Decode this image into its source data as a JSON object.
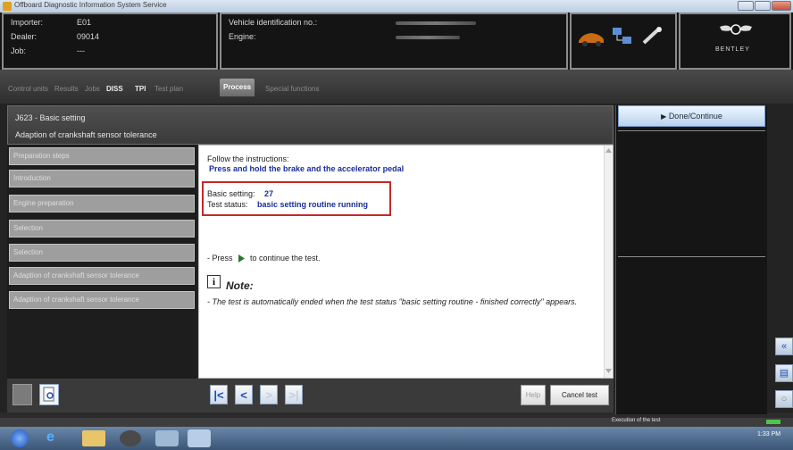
{
  "window": {
    "title": "Offboard Diagnostic Information System Service"
  },
  "header": {
    "importer_label": "Importer:",
    "importer_value": "E01",
    "dealer_label": "Dealer:",
    "dealer_value": "09014",
    "job_label": "Job:",
    "job_value": "---",
    "vin_label": "Vehicle identification no.:",
    "engine_label": "Engine:",
    "brand": "BENTLEY"
  },
  "tabs": [
    {
      "label": "Control units"
    },
    {
      "label": "Results"
    },
    {
      "label": "Jobs"
    },
    {
      "label": "DISS"
    },
    {
      "label": "TPI"
    },
    {
      "label": "Test plan"
    },
    {
      "label": "Process"
    },
    {
      "label": "Special functions"
    }
  ],
  "panel": {
    "title": "J623 - Basic setting",
    "subtitle": "Adaption of crankshaft sensor tolerance"
  },
  "steps": [
    {
      "label": "Preparation steps"
    },
    {
      "label": "Introduction"
    },
    {
      "label": "Engine preparation"
    },
    {
      "label": "Selection"
    },
    {
      "label": "Selection"
    },
    {
      "label": "Adaption of crankshaft sensor tolerance"
    },
    {
      "label": "Adaption of crankshaft sensor tolerance"
    }
  ],
  "content": {
    "instructions_prefix": "Follow the instructions:",
    "instruction": "Press and hold the brake and the accelerator pedal",
    "basic_setting_label": "Basic setting:",
    "basic_setting_value": "27",
    "test_status_label": "Test status:",
    "test_status_value": "basic setting routine running",
    "press_prefix": "- Press",
    "press_suffix": "to continue the test.",
    "note_title": "Note:",
    "note_text": "- The test is automatically ended when the test status \"basic setting routine - finished correctly\" appears."
  },
  "right_panel": {
    "done_label": "Done/Continue"
  },
  "bottom_bar": {
    "help_label": "Help",
    "cancel_label": "Cancel test"
  },
  "status_bar": {
    "text": "Execution of the test"
  },
  "taskbar": {
    "time": "1:33 PM"
  }
}
